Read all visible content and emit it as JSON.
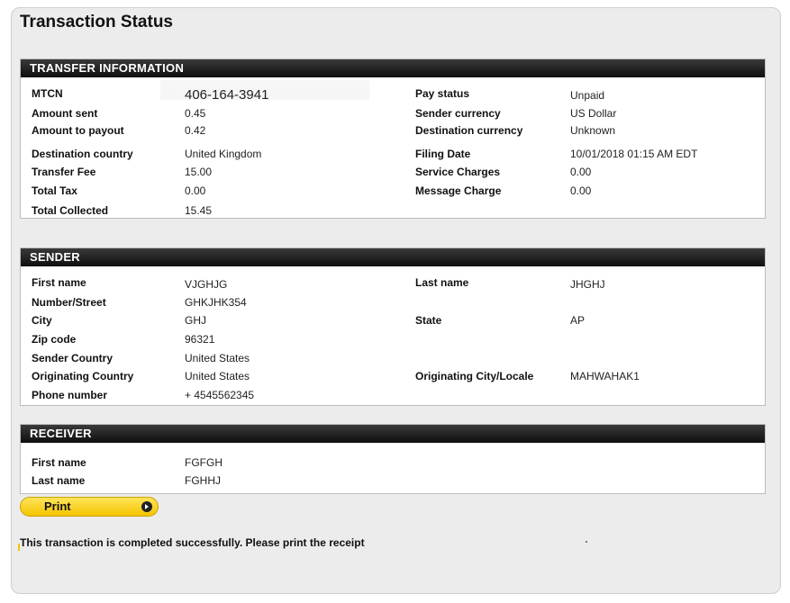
{
  "page": {
    "title": "Transaction Status"
  },
  "transfer": {
    "header": "TRANSFER INFORMATION",
    "left": [
      {
        "label": "MTCN",
        "value": "406-164-3941"
      },
      {
        "label": "Amount sent",
        "value": "0.45"
      },
      {
        "label": "Amount to payout",
        "value": "0.42"
      },
      {
        "label": "Destination country",
        "value": "United Kingdom"
      },
      {
        "label": "Transfer Fee",
        "value": "15.00"
      },
      {
        "label": "Total Tax",
        "value": "0.00"
      },
      {
        "label": "Total Collected",
        "value": "15.45"
      }
    ],
    "right": [
      {
        "label": "Pay status",
        "value": "Unpaid"
      },
      {
        "label": "Sender currency",
        "value": "US Dollar"
      },
      {
        "label": "Destination currency",
        "value": "Unknown"
      },
      {
        "label": "Filing Date",
        "value": "10/01/2018 01:15 AM EDT"
      },
      {
        "label": "Service Charges",
        "value": "0.00"
      },
      {
        "label": "Message Charge",
        "value": "0.00"
      }
    ]
  },
  "sender": {
    "header": "SENDER",
    "left": [
      {
        "label": "First name",
        "value": "VJGHJG"
      },
      {
        "label": "Number/Street",
        "value": "GHKJHK354"
      },
      {
        "label": "City",
        "value": "GHJ"
      },
      {
        "label": "Zip code",
        "value": "96321"
      },
      {
        "label": "Sender Country",
        "value": "United States"
      },
      {
        "label": "Originating Country",
        "value": "United States"
      },
      {
        "label": "Phone number",
        "value": "+ 4545562345"
      }
    ],
    "right": [
      {
        "label": "Last name",
        "value": "JHGHJ"
      },
      {
        "label": "State",
        "value": "AP"
      },
      {
        "label": "Originating City/Locale",
        "value": "MAHWAHAK1"
      }
    ]
  },
  "receiver": {
    "header": "RECEIVER",
    "left": [
      {
        "label": "First name",
        "value": "FGFGH"
      },
      {
        "label": "Last name",
        "value": "FGHHJ"
      }
    ]
  },
  "actions": {
    "print_label": "Print"
  },
  "status": {
    "message": "This transaction is completed successfully. Please print the receipt"
  },
  "colors": {
    "header_bg": "#111111",
    "button_yellow": "#f5c400",
    "panel_bg": "#ececec"
  }
}
